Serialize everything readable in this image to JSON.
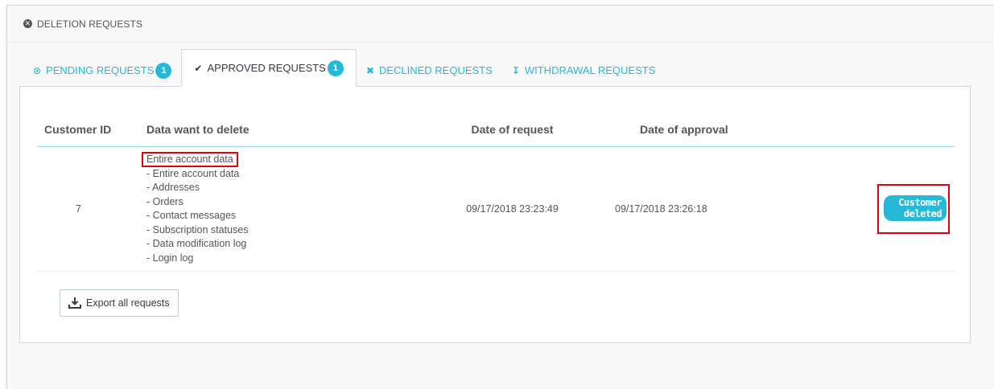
{
  "panel": {
    "title": "DELETION REQUESTS",
    "icon": "remove-circle-icon"
  },
  "tabs": [
    {
      "label": "PENDING REQUESTS",
      "icon": "clock-icon",
      "icon_glyph": "⊙",
      "count": "1"
    },
    {
      "label": "APPROVED REQUESTS",
      "icon": "check-icon",
      "icon_glyph": "✔",
      "count": "1"
    },
    {
      "label": "DECLINED REQUESTS",
      "icon": "times-icon",
      "icon_glyph": "✖"
    },
    {
      "label": "WITHDRAWAL REQUESTS",
      "icon": "arrow-down-icon",
      "icon_glyph": "↧"
    }
  ],
  "table": {
    "headers": [
      "Customer ID",
      "Data want to delete",
      "Date of request",
      "Date of approval",
      ""
    ],
    "rows": [
      {
        "customer_id": "7",
        "data_main": "Entire account data",
        "data_items": [
          "Entire account data",
          "Addresses",
          "Orders",
          "Contact messages",
          "Subscription statuses",
          "Data modification log",
          "Login log"
        ],
        "date_request": "09/17/2018 23:23:49",
        "date_approval": "09/17/2018 23:26:18",
        "status": "Customer deleted"
      }
    ]
  },
  "export_button": {
    "label": "Export all requests",
    "icon": "download-icon"
  },
  "colors": {
    "accent": "#25b9d7",
    "highlight": "#e3000f",
    "text": "#363a41"
  }
}
